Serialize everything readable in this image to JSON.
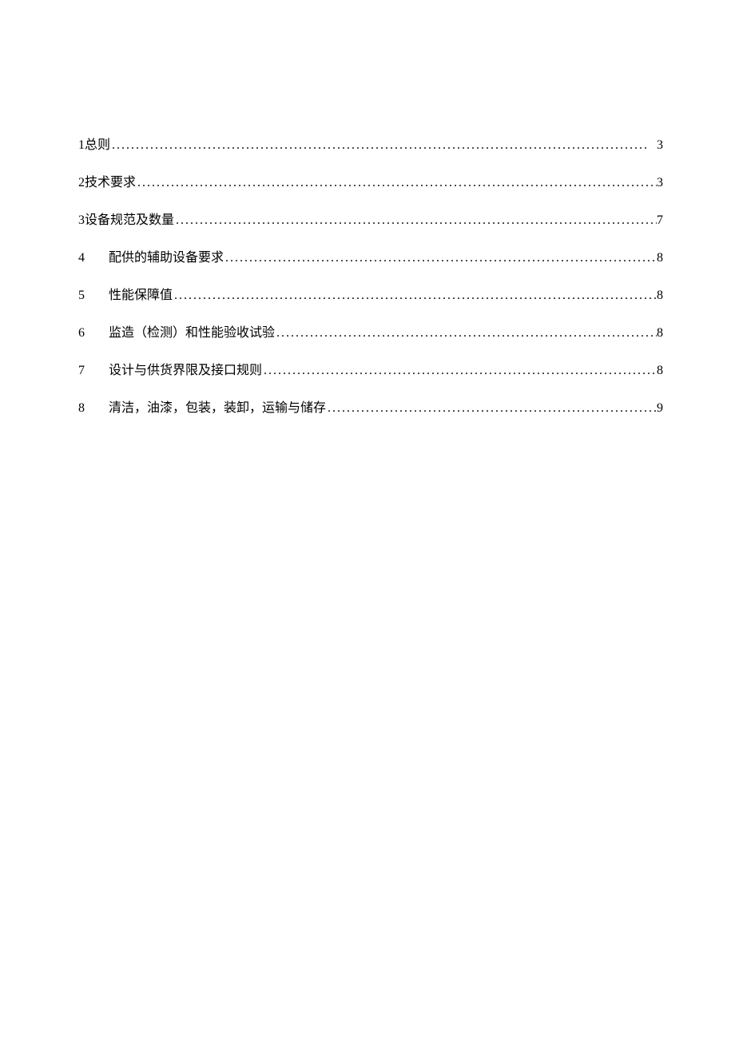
{
  "toc": {
    "entries": [
      {
        "num": "1",
        "title": "总则",
        "page": "3",
        "wide": false
      },
      {
        "num": "2",
        "title": "技术要求",
        "page": "3",
        "wide": false
      },
      {
        "num": "3",
        "title": "设备规范及数量",
        "page": "7",
        "wide": false
      },
      {
        "num": "4",
        "title": "配供的辅助设备要求",
        "page": "8",
        "wide": true
      },
      {
        "num": "5",
        "title": "性能保障值",
        "page": "8",
        "wide": true
      },
      {
        "num": "6",
        "title": "监造（检测）和性能验收试验",
        "page": "8",
        "wide": true
      },
      {
        "num": "7",
        "title": "设计与供货界限及接口规则",
        "page": "8",
        "wide": true
      },
      {
        "num": "8",
        "title": "清洁，油漆，包装，装卸，运输与储存",
        "page": "9",
        "wide": true
      }
    ]
  },
  "dots": "................................................................................................................"
}
